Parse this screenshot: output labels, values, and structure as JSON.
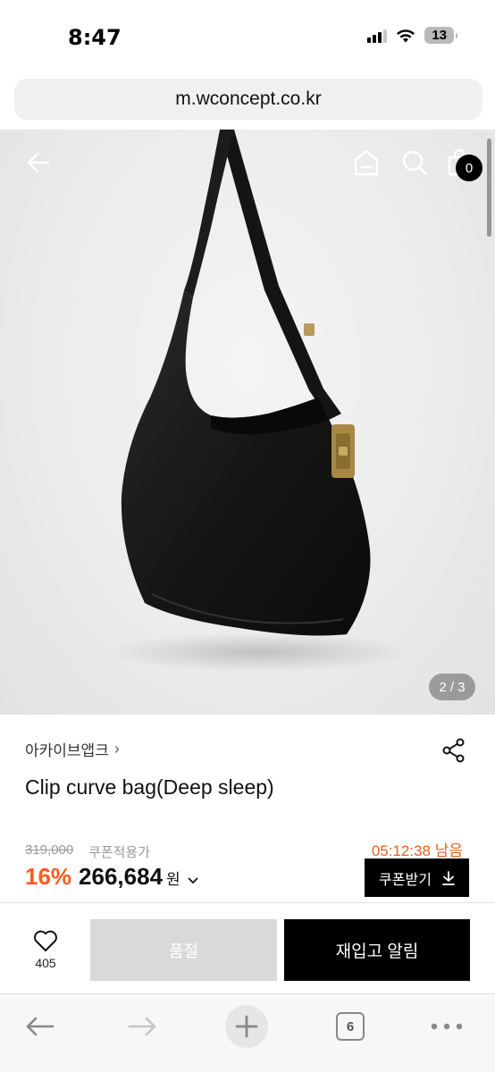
{
  "status_bar": {
    "time": "8:47",
    "battery": "13"
  },
  "browser": {
    "url": "m.wconcept.co.kr",
    "tab_count": "6"
  },
  "header": {
    "cart_count": "0"
  },
  "gallery": {
    "indicator": "2 / 3"
  },
  "product": {
    "brand": "아카이브앱크",
    "name": "Clip curve bag(Deep sleep)",
    "original_price": "319,000",
    "coupon_label": "쿠폰적용가",
    "countdown": "05:12:38 남음",
    "discount": "16%",
    "price": "266,684",
    "currency": "원",
    "coupon_button": "쿠폰받기"
  },
  "actions": {
    "wish_count": "405",
    "soldout_label": "품절",
    "restock_label": "재입고 알림"
  },
  "icons": {
    "back": "arrow-left-icon",
    "home": "home-icon",
    "search": "search-icon",
    "cart": "shopping-bag-icon",
    "share": "share-icon",
    "wish": "heart-icon",
    "download": "download-icon"
  },
  "colors": {
    "accent_orange": "#ff5a1f",
    "countdown_orange": "#e8601c",
    "primary_black": "#000000",
    "soldout_gray": "#d9d9d9"
  }
}
